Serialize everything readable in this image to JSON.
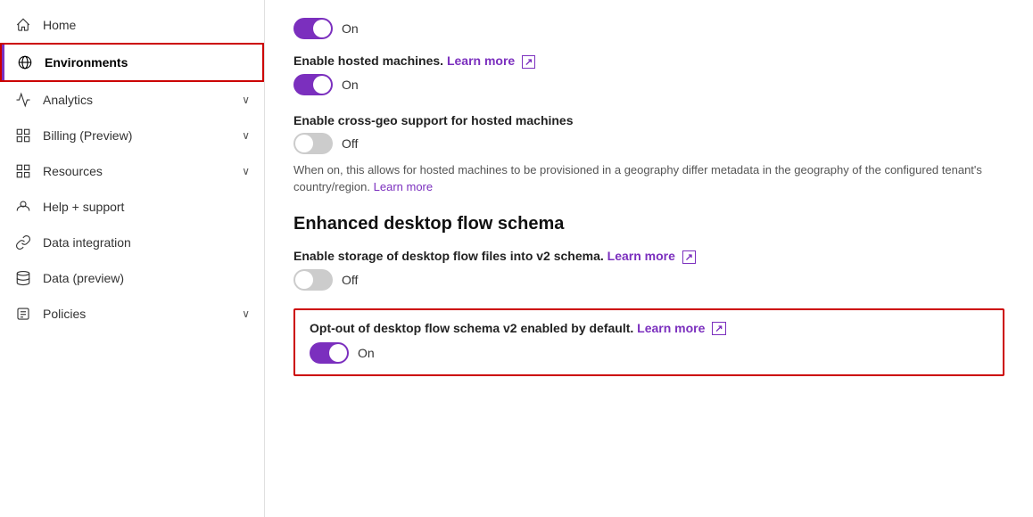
{
  "sidebar": {
    "items": [
      {
        "id": "home",
        "label": "Home",
        "icon": "🏠",
        "hasChevron": false,
        "active": false
      },
      {
        "id": "environments",
        "label": "Environments",
        "icon": "🌐",
        "hasChevron": false,
        "active": true
      },
      {
        "id": "analytics",
        "label": "Analytics",
        "icon": "📈",
        "hasChevron": true,
        "active": false
      },
      {
        "id": "billing",
        "label": "Billing (Preview)",
        "icon": "▦",
        "hasChevron": true,
        "active": false
      },
      {
        "id": "resources",
        "label": "Resources",
        "icon": "▦",
        "hasChevron": true,
        "active": false
      },
      {
        "id": "help",
        "label": "Help + support",
        "icon": "🎧",
        "hasChevron": false,
        "active": false
      },
      {
        "id": "data-integration",
        "label": "Data integration",
        "icon": "🔗",
        "hasChevron": false,
        "active": false
      },
      {
        "id": "data-preview",
        "label": "Data (preview)",
        "icon": "💾",
        "hasChevron": false,
        "active": false
      },
      {
        "id": "policies",
        "label": "Policies",
        "icon": "📋",
        "hasChevron": true,
        "active": false
      }
    ]
  },
  "main": {
    "topToggle": {
      "state": "on",
      "label": "On"
    },
    "hostedMachines": {
      "label": "Enable hosted machines.",
      "learnMoreText": "Learn more",
      "toggle": {
        "state": "on",
        "label": "On"
      }
    },
    "crossGeo": {
      "label": "Enable cross-geo support for hosted machines",
      "toggle": {
        "state": "off",
        "label": "Off"
      },
      "description": "When on, this allows for hosted machines to be provisioned in a geography differ metadata in the geography of the configured tenant's country/region.",
      "learnMoreText": "Learn more"
    },
    "sectionTitle": "Enhanced desktop flow schema",
    "desktopFlowStorage": {
      "label": "Enable storage of desktop flow files into v2 schema.",
      "learnMoreText": "Learn more",
      "toggle": {
        "state": "off",
        "label": "Off"
      }
    },
    "optOut": {
      "label": "Opt-out of desktop flow schema v2 enabled by default.",
      "learnMoreText": "Learn more",
      "toggle": {
        "state": "on",
        "label": "On"
      }
    }
  }
}
